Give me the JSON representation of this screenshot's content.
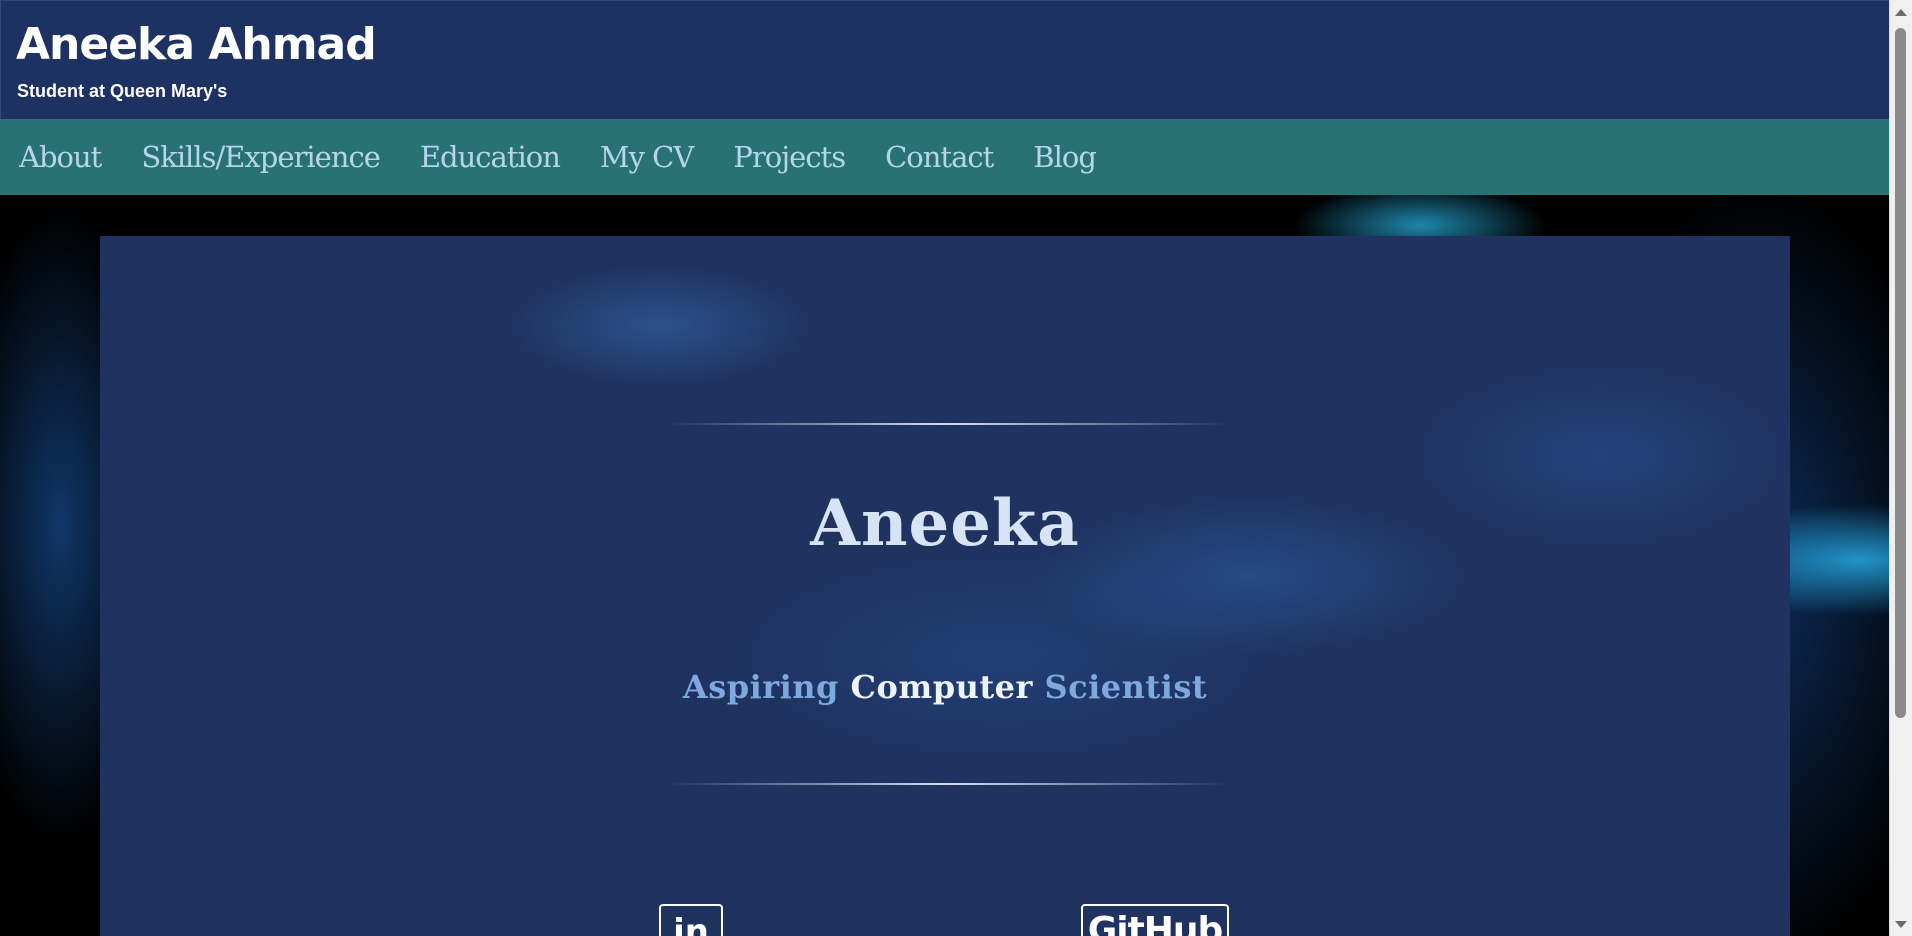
{
  "header": {
    "title": "Aneeka Ahmad",
    "subtitle": "Student at Queen Mary's"
  },
  "nav": {
    "items": [
      {
        "label": "About"
      },
      {
        "label": "Skills/Experience"
      },
      {
        "label": "Education"
      },
      {
        "label": "My CV"
      },
      {
        "label": "Projects"
      },
      {
        "label": "Contact"
      },
      {
        "label": "Blog"
      }
    ]
  },
  "hero": {
    "name": "Aneeka",
    "tagline": {
      "word1": "Aspiring",
      "word2": "Computer",
      "word3": "Scientist"
    }
  },
  "social": {
    "linkedin_label": "in",
    "github_label": "GitHub"
  },
  "colors": {
    "header_bg": "#1d3262",
    "nav_bg": "#287274",
    "nav_text": "#b7d4ee",
    "hero_bg": "#1f3260",
    "accent_light_blue": "#7ea9df"
  },
  "icons": {
    "linkedin": "linkedin-icon",
    "github": "github-icon"
  }
}
